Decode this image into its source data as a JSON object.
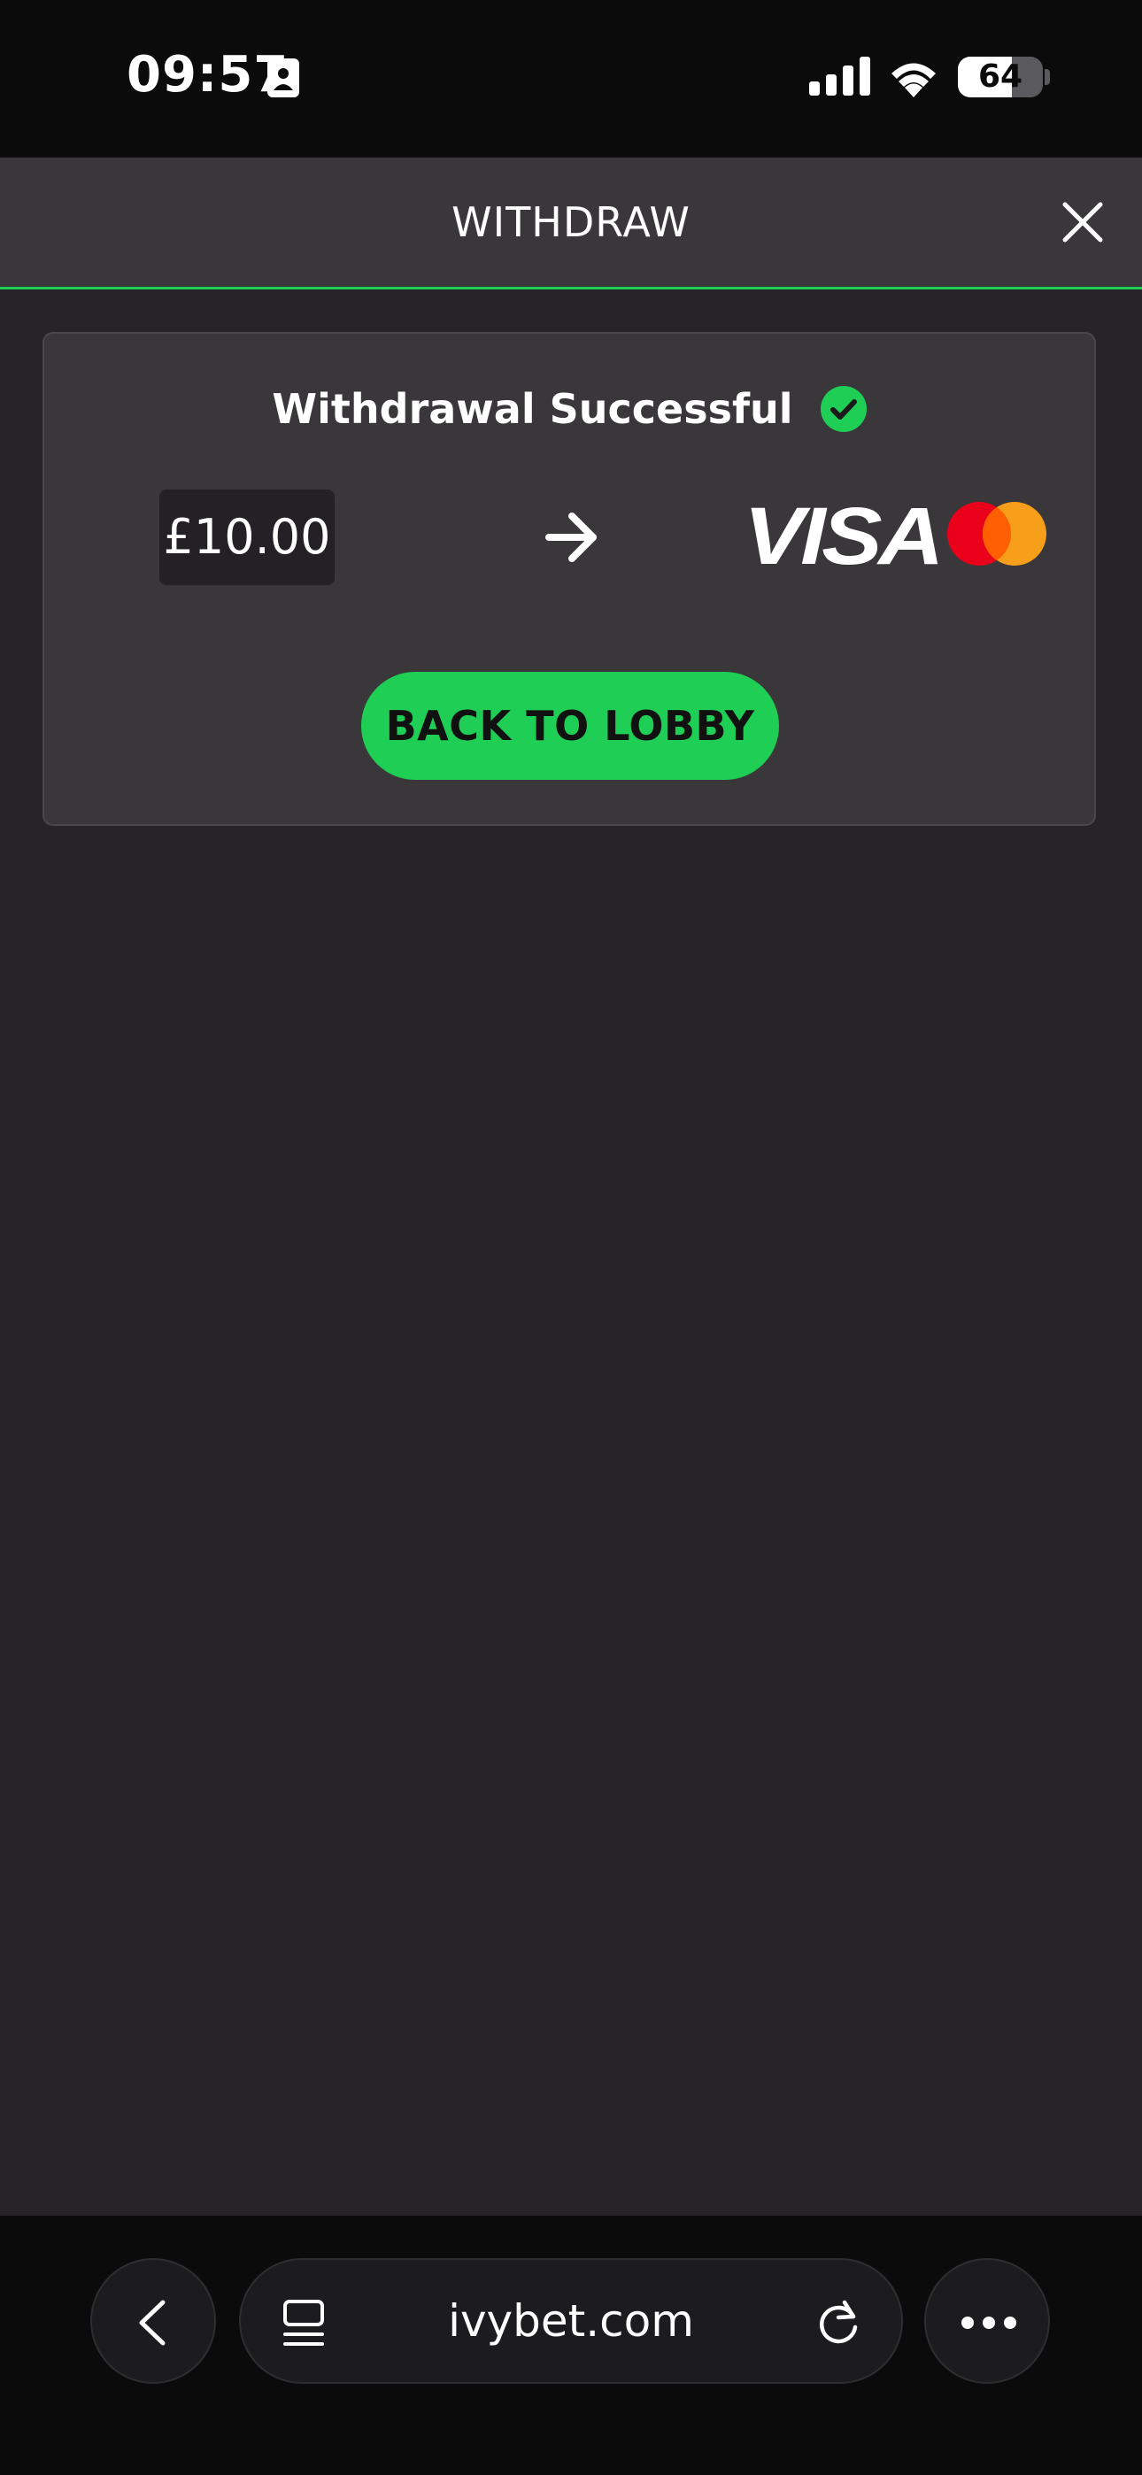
{
  "status_bar": {
    "time": "09:57",
    "battery_percent": 64
  },
  "modal": {
    "title": "WITHDRAW"
  },
  "withdrawal": {
    "status_text": "Withdrawal Successful",
    "amount": "£10.00",
    "card_brand": "VISA",
    "back_button_label": "BACK TO LOBBY"
  },
  "browser": {
    "url": "ivybet.com"
  },
  "colors": {
    "accent_green": "#1fce55",
    "panel": "#3a373b",
    "background": "#262428",
    "mastercard_red": "#eb001b",
    "mastercard_orange": "#f79e1b"
  },
  "icons": {
    "id-card": "id-card-icon",
    "signal": "cellular-signal-icon",
    "wifi": "wifi-icon",
    "close": "close-icon",
    "check": "check-circle-icon",
    "arrow": "arrow-right-icon",
    "back": "chevron-left-icon",
    "tabs": "tabs-icon",
    "reload": "reload-icon",
    "more": "more-dots-icon"
  }
}
